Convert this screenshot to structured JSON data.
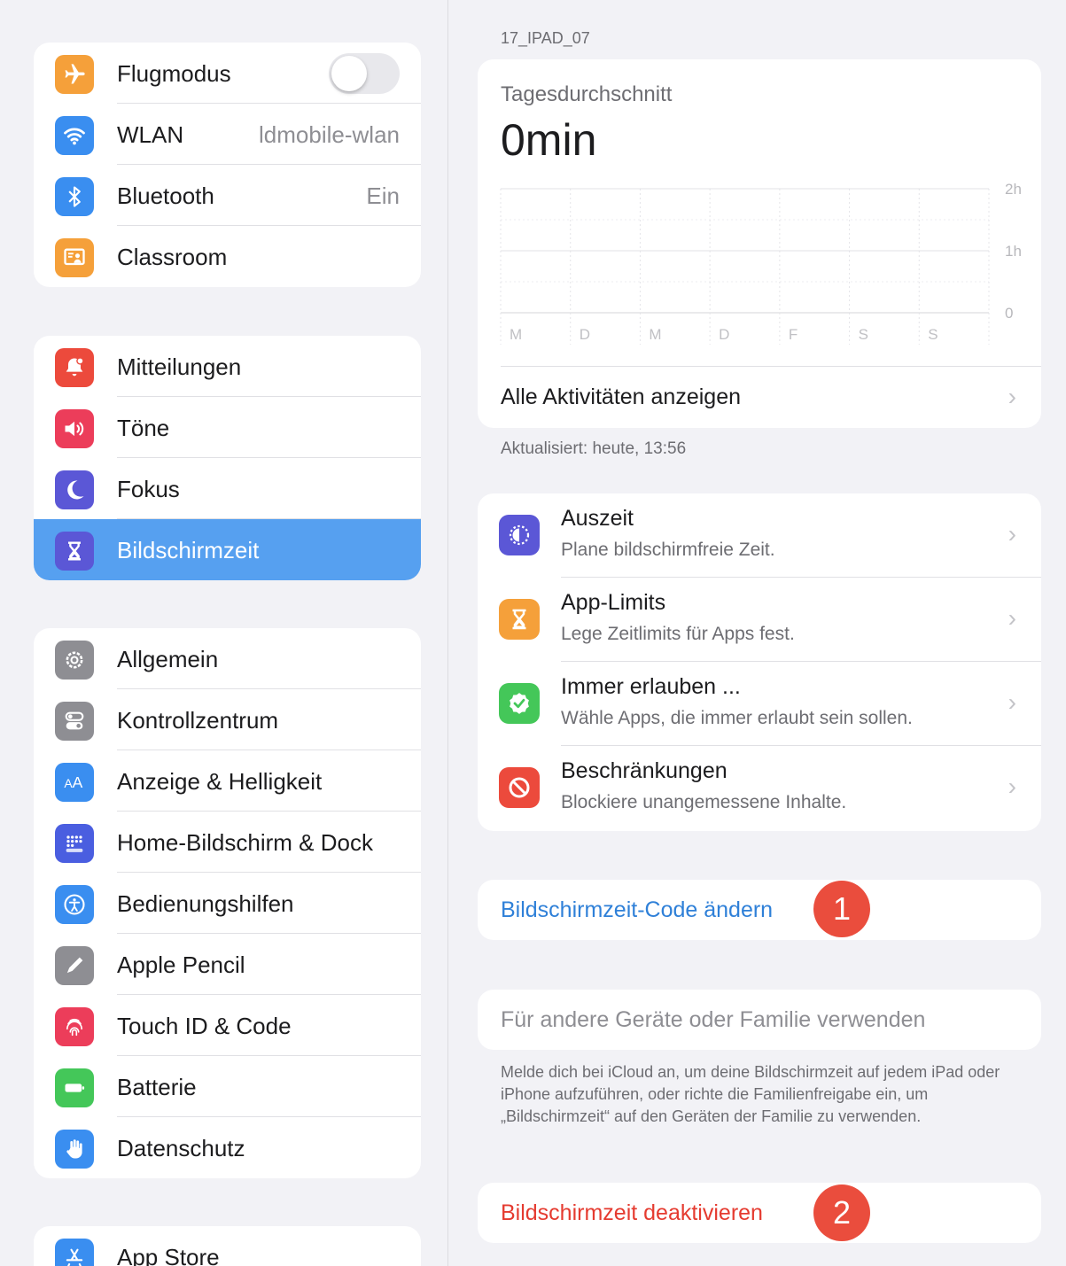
{
  "sidebar": {
    "group1": [
      {
        "label": "Flugmodus",
        "icon": "airplane-icon",
        "color": "#f5a03a",
        "toggle": false
      },
      {
        "label": "WLAN",
        "value": "ldmobile-wlan",
        "icon": "wifi-icon",
        "color": "#3a8ef0"
      },
      {
        "label": "Bluetooth",
        "value": "Ein",
        "icon": "bluetooth-icon",
        "color": "#3a8ef0"
      },
      {
        "label": "Classroom",
        "icon": "classroom-icon",
        "color": "#f5a03a"
      }
    ],
    "group2": [
      {
        "label": "Mitteilungen",
        "icon": "notifications-icon",
        "color": "#ec4a3c"
      },
      {
        "label": "Töne",
        "icon": "speaker-icon",
        "color": "#ec3d5a"
      },
      {
        "label": "Fokus",
        "icon": "moon-icon",
        "color": "#5b57d6"
      },
      {
        "label": "Bildschirmzeit",
        "icon": "hourglass-icon",
        "color": "#5b57d6",
        "selected": true
      }
    ],
    "group3": [
      {
        "label": "Allgemein",
        "icon": "gear-icon",
        "color": "#8e8e93"
      },
      {
        "label": "Kontrollzentrum",
        "icon": "toggles-icon",
        "color": "#8e8e93"
      },
      {
        "label": "Anzeige & Helligkeit",
        "icon": "text-size-icon",
        "color": "#3a8ef0"
      },
      {
        "label": "Home-Bildschirm & Dock",
        "icon": "home-grid-icon",
        "color": "#4a5ee0"
      },
      {
        "label": "Bedienungshilfen",
        "icon": "accessibility-icon",
        "color": "#3a8ef0"
      },
      {
        "label": "Apple Pencil",
        "icon": "pencil-icon",
        "color": "#8e8e93"
      },
      {
        "label": "Touch ID & Code",
        "icon": "fingerprint-icon",
        "color": "#ec3d5a"
      },
      {
        "label": "Batterie",
        "icon": "battery-icon",
        "color": "#44c759"
      },
      {
        "label": "Datenschutz",
        "icon": "hand-icon",
        "color": "#3a8ef0"
      }
    ],
    "group4": [
      {
        "label": "App Store",
        "icon": "app-store-icon",
        "color": "#3a8ef0"
      }
    ]
  },
  "main": {
    "device_name": "17_IPAD_07",
    "avg_label": "Tagesdurchschnitt",
    "avg_value": "0min",
    "all_activities": "Alle Aktivitäten anzeigen",
    "updated": "Aktualisiert: heute, 13:56",
    "options": [
      {
        "title": "Auszeit",
        "subtitle": "Plane bildschirmfreie Zeit.",
        "icon": "downtime-icon",
        "color": "#5b57d6"
      },
      {
        "title": "App-Limits",
        "subtitle": "Lege Zeitlimits für Apps fest.",
        "icon": "hourglass-icon",
        "color": "#f5a03a"
      },
      {
        "title": "Immer erlauben ...",
        "subtitle": "Wähle Apps, die immer erlaubt sein sollen.",
        "icon": "checkmark-badge-icon",
        "color": "#44c759"
      },
      {
        "title": "Beschränkungen",
        "subtitle": "Blockiere unangemessene Inhalte.",
        "icon": "prohibited-icon",
        "color": "#ec4a3c"
      }
    ],
    "change_code": "Bildschirmzeit-Code ändern",
    "badge1": "1",
    "family": "Für andere Geräte oder Familie verwenden",
    "footnote": "Melde dich bei iCloud an, um deine Bildschirmzeit auf jedem iPad oder iPhone aufzuführen, oder richte die Familienfreigabe ein, um „Bildschirmzeit“ auf den Geräten der Familie zu verwenden.",
    "deactivate": "Bildschirmzeit deaktivieren",
    "badge2": "2"
  },
  "chart_data": {
    "type": "bar",
    "categories": [
      "M",
      "D",
      "M",
      "D",
      "F",
      "S",
      "S"
    ],
    "values": [
      0,
      0,
      0,
      0,
      0,
      0,
      0
    ],
    "y_ticks": [
      "2h",
      "1h",
      "0"
    ],
    "ylim": [
      0,
      2
    ]
  }
}
